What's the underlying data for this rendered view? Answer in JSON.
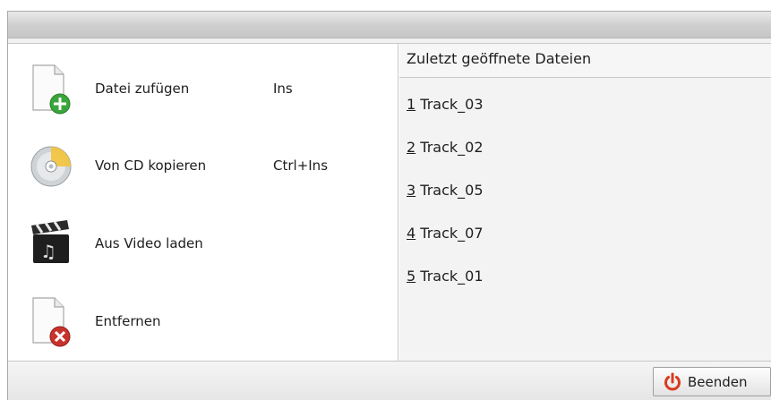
{
  "menu": {
    "items": [
      {
        "label": "Datei zufügen",
        "shortcut": "Ins",
        "icon": "add-file-icon"
      },
      {
        "label": "Von CD kopieren",
        "shortcut": "Ctrl+Ins",
        "icon": "cd-icon"
      },
      {
        "label": "Aus Video laden",
        "shortcut": "",
        "icon": "video-clapper-icon"
      },
      {
        "label": "Entfernen",
        "shortcut": "",
        "icon": "remove-file-icon"
      }
    ]
  },
  "recent": {
    "header": "Zuletzt geöffnete Dateien",
    "items": [
      {
        "num": "1",
        "name": "Track_03"
      },
      {
        "num": "2",
        "name": "Track_02"
      },
      {
        "num": "3",
        "name": "Track_05"
      },
      {
        "num": "4",
        "name": "Track_07"
      },
      {
        "num": "5",
        "name": "Track_01"
      }
    ]
  },
  "footer": {
    "quit_label": "Beenden",
    "quit_icon": "power-icon"
  },
  "colors": {
    "add_green": "#3aa53a",
    "remove_red": "#c8322d",
    "power_red": "#d93a1e"
  }
}
